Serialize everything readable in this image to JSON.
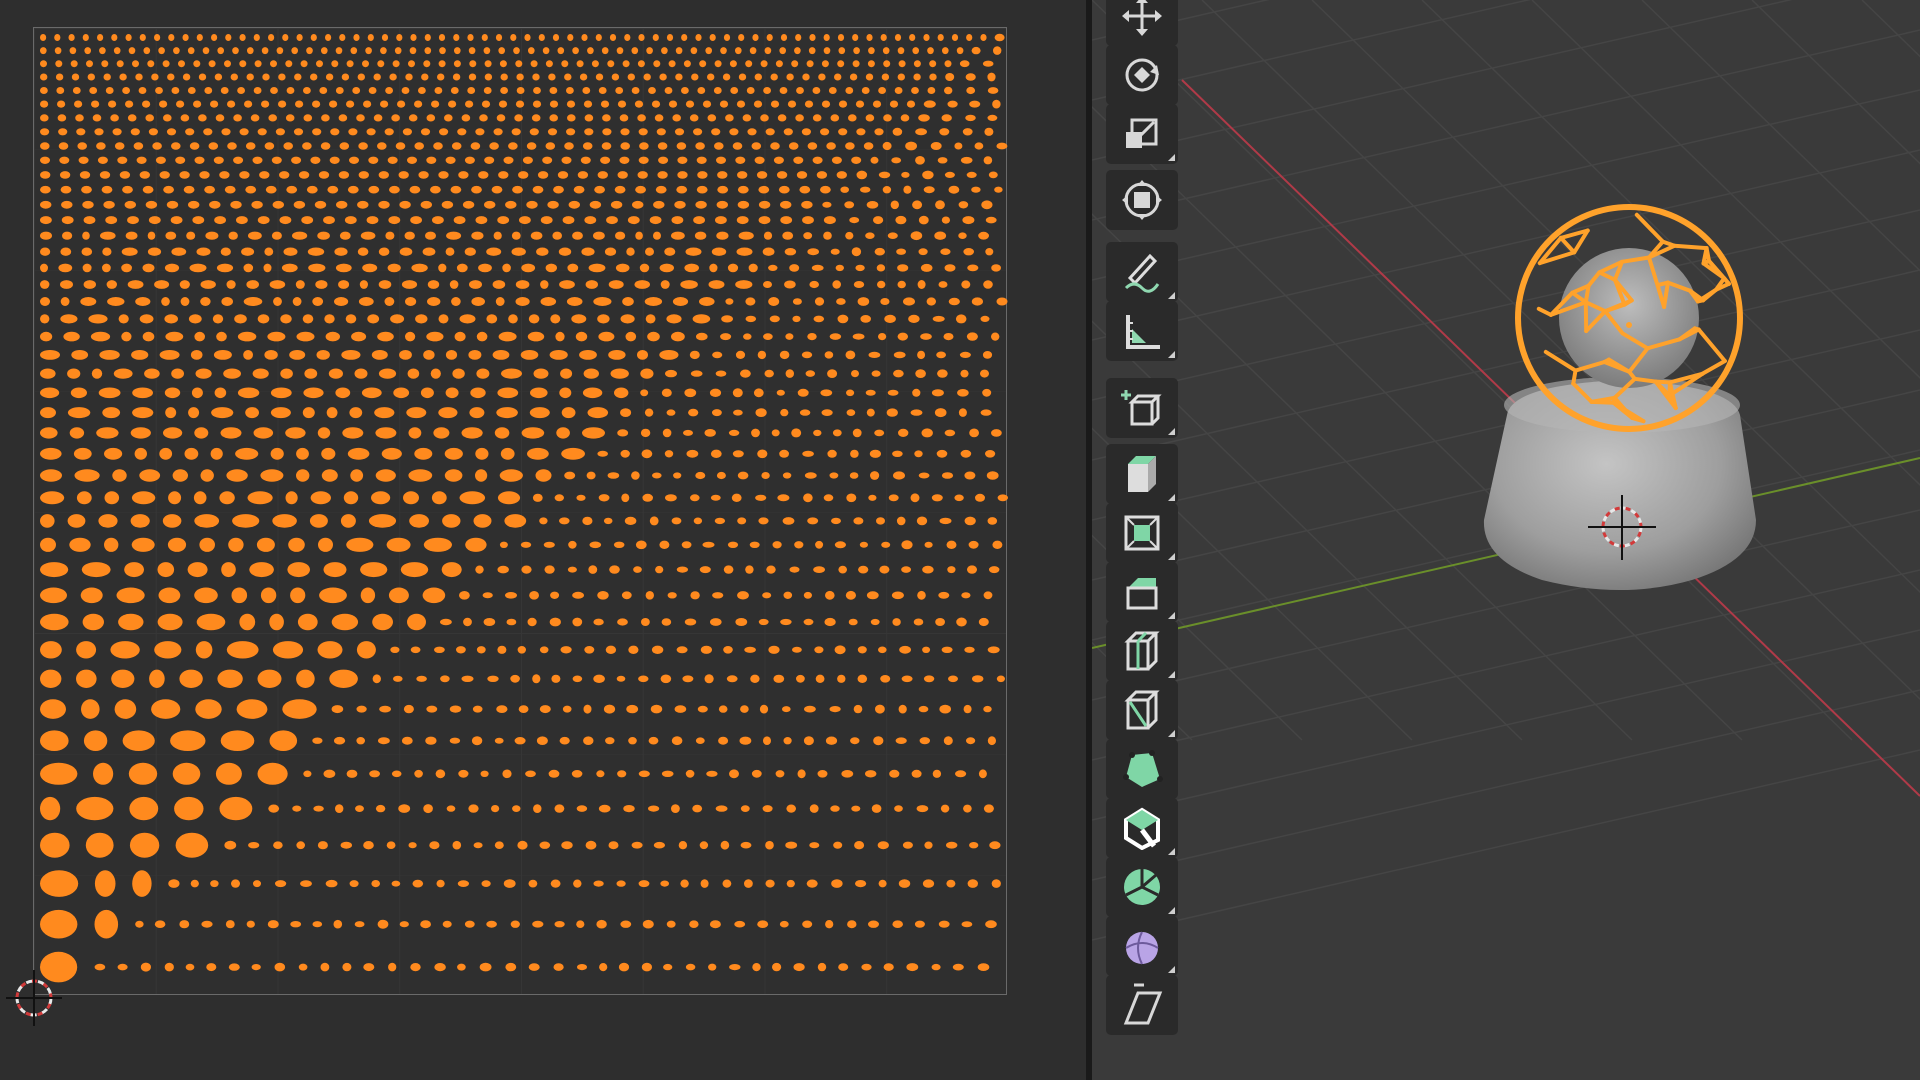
{
  "editor": {
    "uv_island_color": "#ff8a1e",
    "uv_frame_color": "#6a6a6a",
    "uv_background": "#2f2f2f"
  },
  "viewport": {
    "background": "#3a3a3a",
    "grid_color": "#454545",
    "x_axis_color": "#b03a48",
    "y_axis_color": "#6a8f2a",
    "selection_color": "#ffa22b",
    "base_color": "#a8a8a8"
  },
  "toolbar": {
    "tools": [
      {
        "name": "move-icon",
        "accent": "#d8d8d8"
      },
      {
        "name": "rotate-icon",
        "accent": "#d8d8d8"
      },
      {
        "name": "scale-icon",
        "accent": "#d8d8d8"
      },
      {
        "name": "transform-icon",
        "accent": "#d8d8d8"
      },
      {
        "name": "annotate-icon",
        "accent": "#8fd8b0"
      },
      {
        "name": "measure-icon",
        "accent": "#8fd8b0"
      },
      {
        "name": "add-cube-icon",
        "accent": "#8fd8b0"
      },
      {
        "name": "extrude-region-icon",
        "accent": "#7fd6a6"
      },
      {
        "name": "inset-faces-icon",
        "accent": "#7fd6a6"
      },
      {
        "name": "bevel-icon",
        "accent": "#7fd6a6"
      },
      {
        "name": "loop-cut-icon",
        "accent": "#7fd6a6"
      },
      {
        "name": "knife-icon",
        "accent": "#7fd6a6"
      },
      {
        "name": "poly-build-icon",
        "accent": "#7fd6a6"
      },
      {
        "name": "spin-icon",
        "accent": "#7fd6a6"
      },
      {
        "name": "smooth-icon",
        "accent": "#7fd6a6"
      },
      {
        "name": "shrink-fatten-icon",
        "accent": "#b9a4e6"
      },
      {
        "name": "shear-icon",
        "accent": "#d8d8d8"
      }
    ]
  }
}
